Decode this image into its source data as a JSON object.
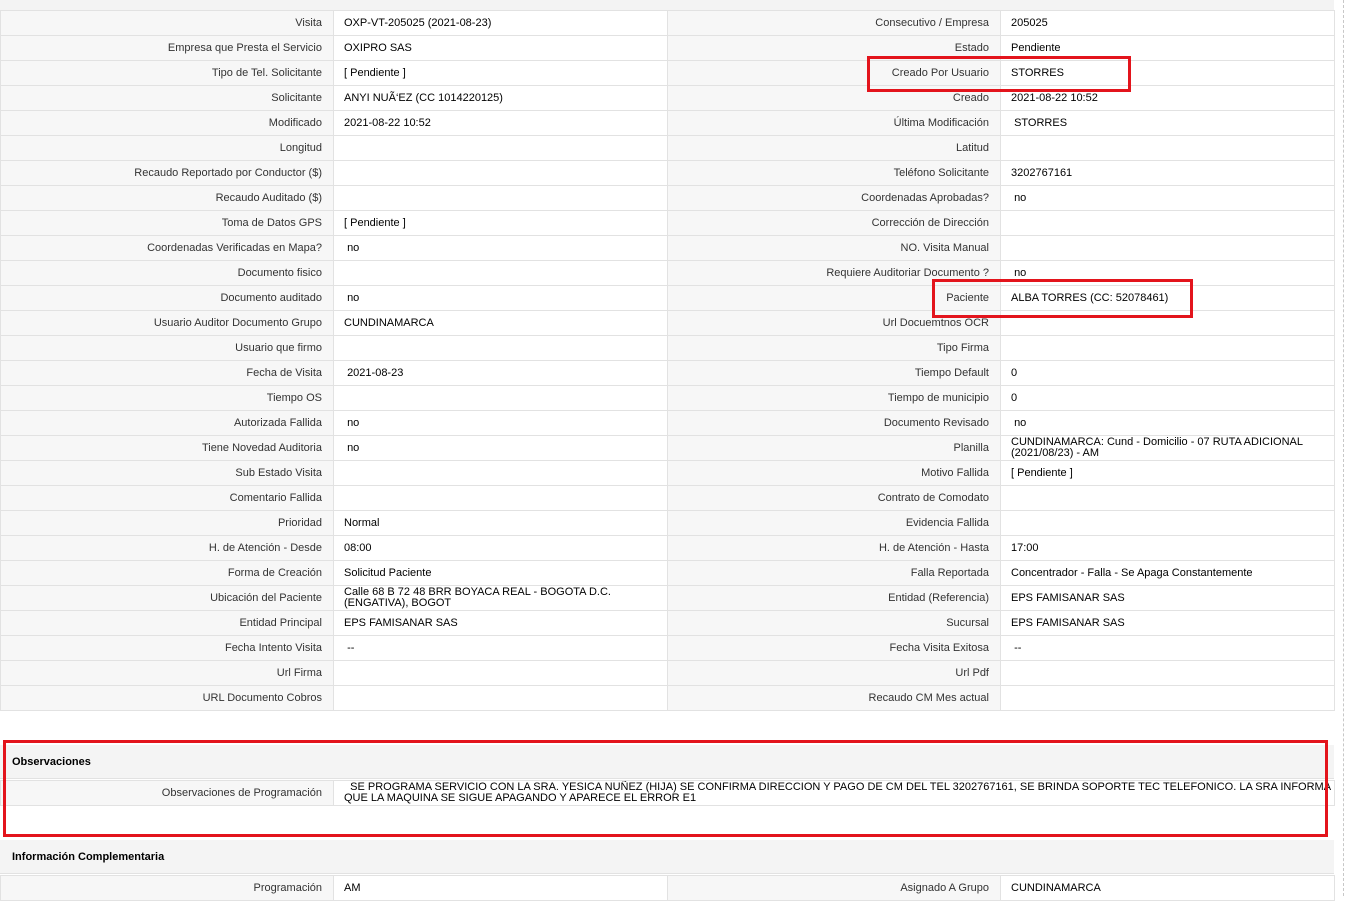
{
  "rows": [
    {
      "l1": "Visita",
      "v1": "OXP-VT-205025 (2021-08-23)",
      "l2": "Consecutivo / Empresa",
      "v2": "205025"
    },
    {
      "l1": "Empresa que Presta el Servicio",
      "v1": "OXIPRO SAS",
      "l2": "Estado",
      "v2": "Pendiente"
    },
    {
      "l1": "Tipo de Tel. Solicitante",
      "v1": "[ Pendiente ]",
      "l2": "Creado Por Usuario",
      "v2": "STORRES"
    },
    {
      "l1": "Solicitante",
      "v1": "ANYI NUÃ‘EZ (CC 1014220125)",
      "l2": "Creado",
      "v2": "2021-08-22 10:52"
    },
    {
      "l1": "Modificado",
      "v1": "2021-08-22 10:52",
      "l2": "Última Modificación",
      "v2": " STORRES"
    },
    {
      "l1": "Longitud",
      "v1": "",
      "l2": "Latitud",
      "v2": ""
    },
    {
      "l1": "Recaudo Reportado por Conductor ($)",
      "v1": "",
      "l2": "Teléfono Solicitante",
      "v2": "3202767161"
    },
    {
      "l1": "Recaudo Auditado ($)",
      "v1": "",
      "l2": "Coordenadas Aprobadas?",
      "v2": " no"
    },
    {
      "l1": "Toma de Datos GPS",
      "v1": "[ Pendiente ]",
      "l2": "Corrección de Dirección",
      "v2": ""
    },
    {
      "l1": "Coordenadas Verificadas en Mapa?",
      "v1": " no",
      "l2": "NO. Visita Manual",
      "v2": ""
    },
    {
      "l1": "Documento fisico",
      "v1": "",
      "l2": "Requiere Auditoriar Documento ?",
      "v2": " no"
    },
    {
      "l1": "Documento auditado",
      "v1": " no",
      "l2": "Paciente",
      "v2": "ALBA TORRES (CC: 52078461)"
    },
    {
      "l1": "Usuario Auditor Documento Grupo",
      "v1": "CUNDINAMARCA",
      "l2": "Url Docuemtnos OCR",
      "v2": ""
    },
    {
      "l1": "Usuario que firmo",
      "v1": "",
      "l2": "Tipo Firma",
      "v2": ""
    },
    {
      "l1": "Fecha de Visita",
      "v1": " 2021-08-23",
      "l2": "Tiempo Default",
      "v2": "0"
    },
    {
      "l1": "Tiempo OS",
      "v1": "",
      "l2": "Tiempo de municipio",
      "v2": "0"
    },
    {
      "l1": "Autorizada Fallida",
      "v1": " no",
      "l2": "Documento Revisado",
      "v2": " no"
    },
    {
      "l1": "Tiene Novedad Auditoria",
      "v1": " no",
      "l2": "Planilla",
      "v2": "CUNDINAMARCA: Cund - Domicilio - 07 RUTA ADICIONAL (2021/08/23) - AM"
    },
    {
      "l1": "Sub Estado Visita",
      "v1": "",
      "l2": "Motivo Fallida",
      "v2": "[ Pendiente ]"
    },
    {
      "l1": "Comentario Fallida",
      "v1": "",
      "l2": "Contrato de Comodato",
      "v2": ""
    },
    {
      "l1": "Prioridad",
      "v1": "Normal",
      "l2": "Evidencia Fallida",
      "v2": ""
    },
    {
      "l1": "H. de Atención - Desde",
      "v1": "08:00",
      "l2": "H. de Atención - Hasta",
      "v2": "17:00"
    },
    {
      "l1": "Forma de Creación",
      "v1": "Solicitud Paciente",
      "l2": "Falla Reportada",
      "v2": "Concentrador - Falla - Se Apaga Constantemente"
    },
    {
      "l1": "Ubicación del Paciente",
      "v1": "Calle 68 B 72 48 BRR BOYACA REAL - BOGOTA D.C. (ENGATIVA), BOGOT",
      "l2": "Entidad (Referencia)",
      "v2": "EPS FAMISANAR SAS"
    },
    {
      "l1": "Entidad Principal",
      "v1": "EPS FAMISANAR SAS",
      "l2": "Sucursal",
      "v2": "EPS FAMISANAR SAS"
    },
    {
      "l1": "Fecha Intento Visita",
      "v1": " --",
      "l2": "Fecha Visita Exitosa",
      "v2": " --"
    },
    {
      "l1": "Url Firma",
      "v1": "",
      "l2": "Url Pdf",
      "v2": ""
    },
    {
      "l1": "URL Documento Cobros",
      "v1": "",
      "l2": "Recaudo CM Mes actual",
      "v2": ""
    }
  ],
  "observaciones": {
    "title": "Observaciones",
    "label": "Observaciones de Programación",
    "value": "  SE PROGRAMA SERVICIO CON LA SRA. YESICA NUÑEZ (HIJA) SE CONFIRMA DIRECCION Y PAGO DE CM DEL TEL 3202767161, SE BRINDA SOPORTE TEC TELEFONICO. LA SRA INFORMA QUE LA MAQUINA SE SIGUE APAGANDO Y APARECE EL ERROR E1"
  },
  "complementaria": {
    "title": "Información Complementaria",
    "l1": "Programación",
    "v1": "AM",
    "l2": "Asignado A Grupo",
    "v2": "CUNDINAMARCA"
  },
  "colors": {
    "highlight": "#e3141c",
    "label_bg": "#f7f7f7",
    "border": "#e2e2e2"
  }
}
